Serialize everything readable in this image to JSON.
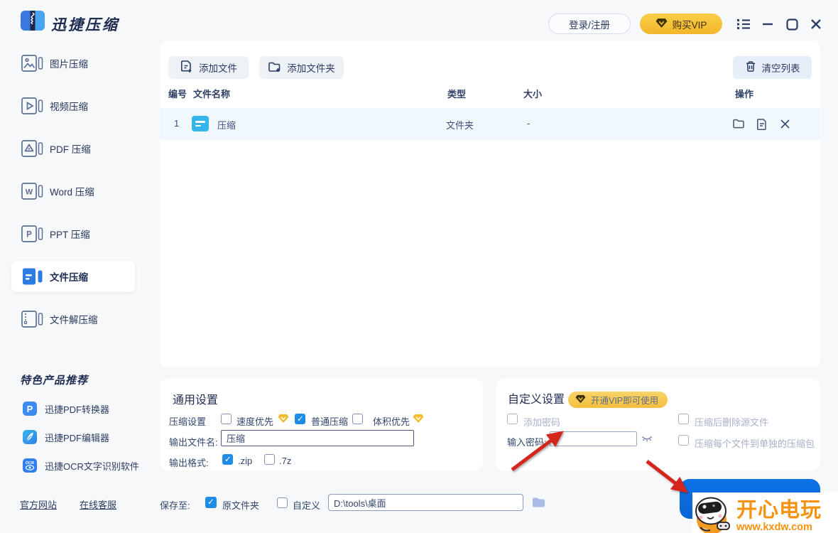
{
  "app": {
    "title": "迅捷压缩"
  },
  "titlebar": {
    "login_label": "登录/注册",
    "buy_vip_label": "购买VIP"
  },
  "sidebar": {
    "items": [
      {
        "label": "图片压缩",
        "selected": false
      },
      {
        "label": "视频压缩",
        "selected": false
      },
      {
        "label": "PDF 压缩",
        "selected": false
      },
      {
        "label": "Word 压缩",
        "selected": false
      },
      {
        "label": "PPT 压缩",
        "selected": false
      },
      {
        "label": "文件压缩",
        "selected": true
      },
      {
        "label": "文件解压缩",
        "selected": false
      }
    ],
    "promo_header": "特色产品推荐",
    "products": [
      {
        "label": "迅捷PDF转换器"
      },
      {
        "label": "迅捷PDF编辑器"
      },
      {
        "label": "迅捷OCR文字识别软件"
      }
    ],
    "links": [
      {
        "label": "官方网站"
      },
      {
        "label": "在线客服"
      }
    ]
  },
  "toolbar": {
    "add_file": "添加文件",
    "add_folder": "添加文件夹",
    "clear_list": "清空列表"
  },
  "table": {
    "headers": {
      "index": "编号",
      "name": "文件名称",
      "type": "类型",
      "size": "大小",
      "ops": "操作"
    },
    "rows": [
      {
        "index": "1",
        "name": "压缩",
        "type": "文件夹",
        "size": "-"
      }
    ]
  },
  "general": {
    "title": "通用设置",
    "compress_label": "压缩设置",
    "opt_speed": {
      "label": "速度优先",
      "checked": false,
      "vip": true
    },
    "opt_normal": {
      "label": "普通压缩",
      "checked": true,
      "vip": false
    },
    "opt_size": {
      "label": "体积优先",
      "checked": false,
      "vip": true
    },
    "output_name_label": "输出文件名:",
    "output_name_value": "压缩",
    "output_format_label": "输出格式:",
    "fmt_zip": {
      "label": ".zip",
      "checked": true
    },
    "fmt_7z": {
      "label": ".7z",
      "checked": false
    }
  },
  "custom": {
    "title": "自定义设置",
    "vip_badge": "开通VIP即可使用",
    "add_password": {
      "label": "添加密码",
      "checked": false
    },
    "password_label": "输入密码:",
    "password_value": "",
    "delete_source": {
      "label": "压缩后删除源文件",
      "checked": false
    },
    "separate": {
      "label": "压缩每个文件到单独的压缩包",
      "checked": false
    }
  },
  "savebar": {
    "label": "保存至:",
    "original": {
      "label": "原文件夹",
      "checked": true
    },
    "custom": {
      "label": "自定义",
      "checked": false
    },
    "path": "D:\\tools\\桌面"
  },
  "watermark": {
    "title": "开心电玩",
    "url": "www.kxdw.com"
  },
  "colors": {
    "accent_blue": "#0d6fe0",
    "vip_yellow": "#f6c63c",
    "check_blue": "#1f8ce8",
    "arrow_red": "#d5281f",
    "row_bg": "#f1f8fd",
    "file_icon_cyan": "#35b5e9",
    "navy_text": "#2c3d63"
  }
}
